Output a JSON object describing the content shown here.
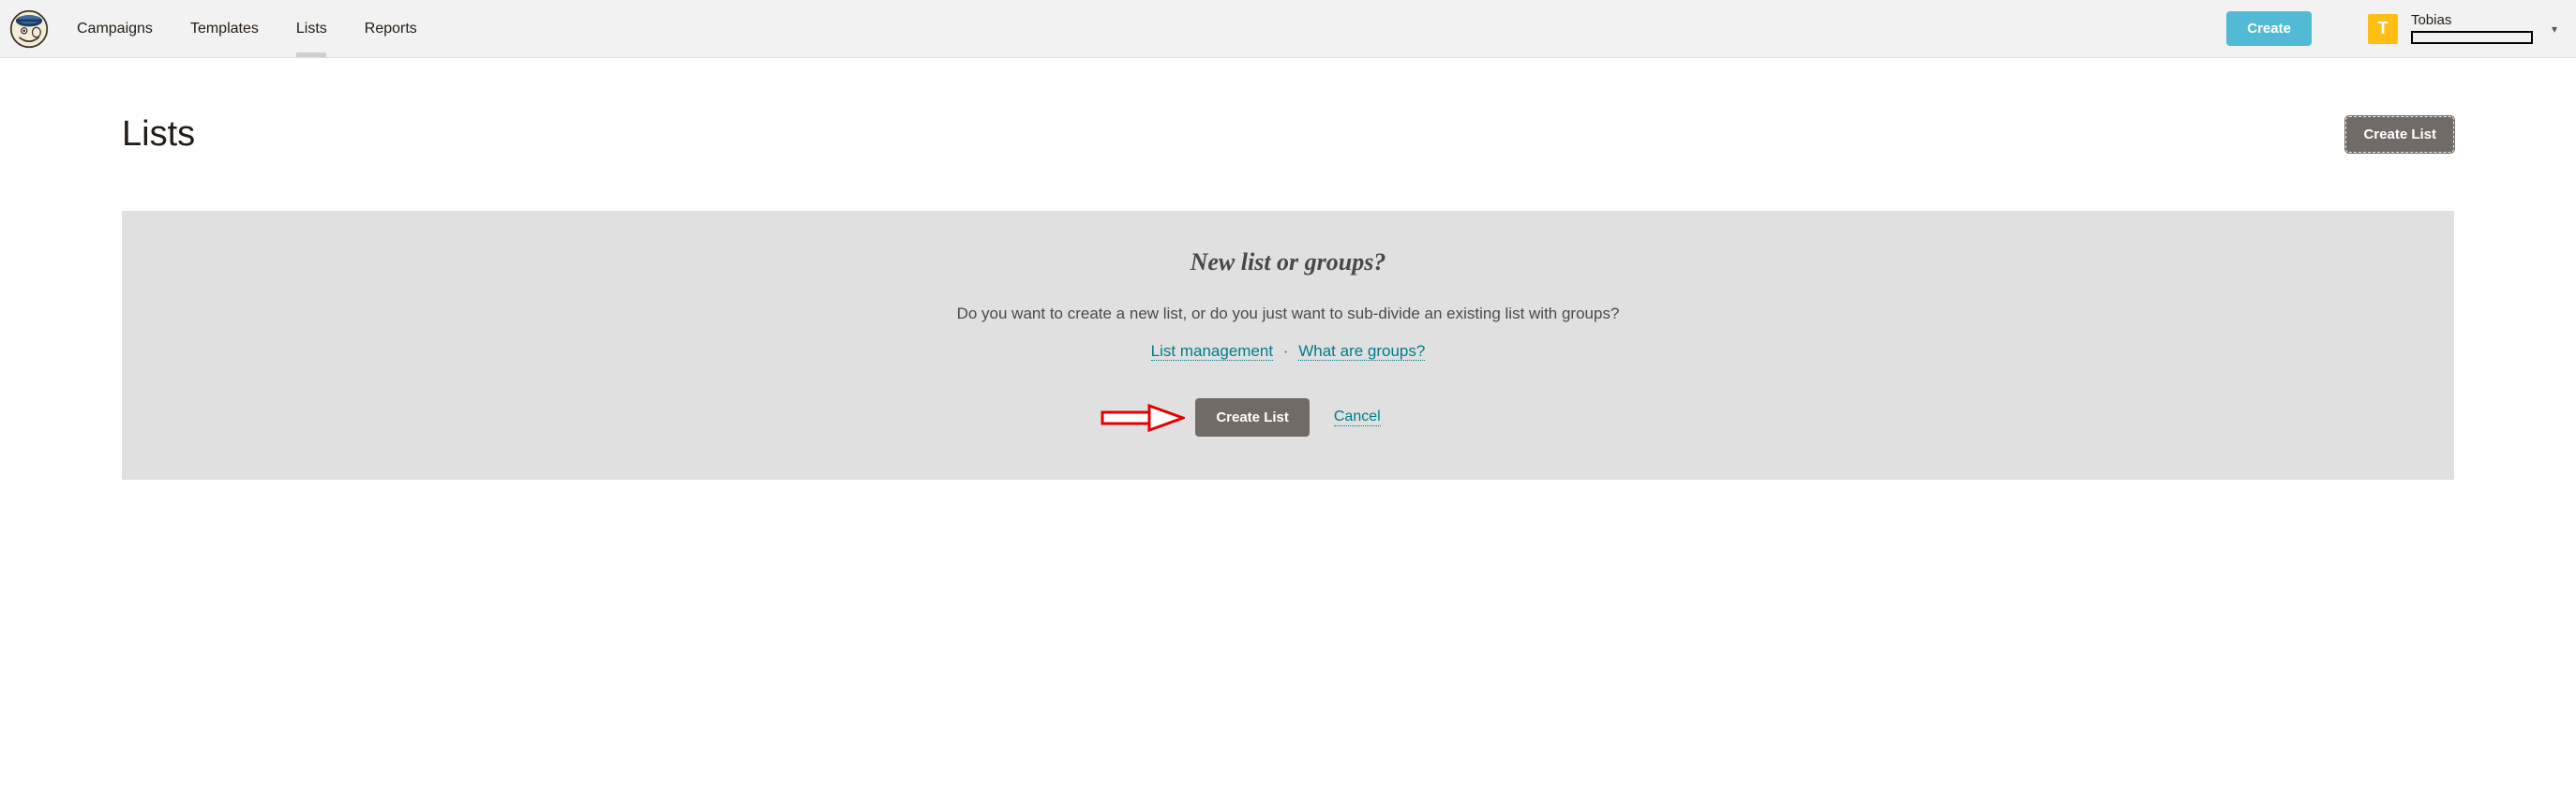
{
  "nav": {
    "items": [
      {
        "label": "Campaigns"
      },
      {
        "label": "Templates"
      },
      {
        "label": "Lists",
        "active": true
      },
      {
        "label": "Reports"
      }
    ],
    "create_button": "Create",
    "account": {
      "initial": "T",
      "name": "Tobias"
    }
  },
  "page": {
    "title": "Lists",
    "create_list_button": "Create List"
  },
  "panel": {
    "heading": "New list or groups?",
    "question": "Do you want to create a new list, or do you just want to sub-divide an existing list with groups?",
    "link_list_mgmt": "List management",
    "link_groups": "What are groups?",
    "separator": "·",
    "create_button": "Create List",
    "cancel_link": "Cancel"
  }
}
